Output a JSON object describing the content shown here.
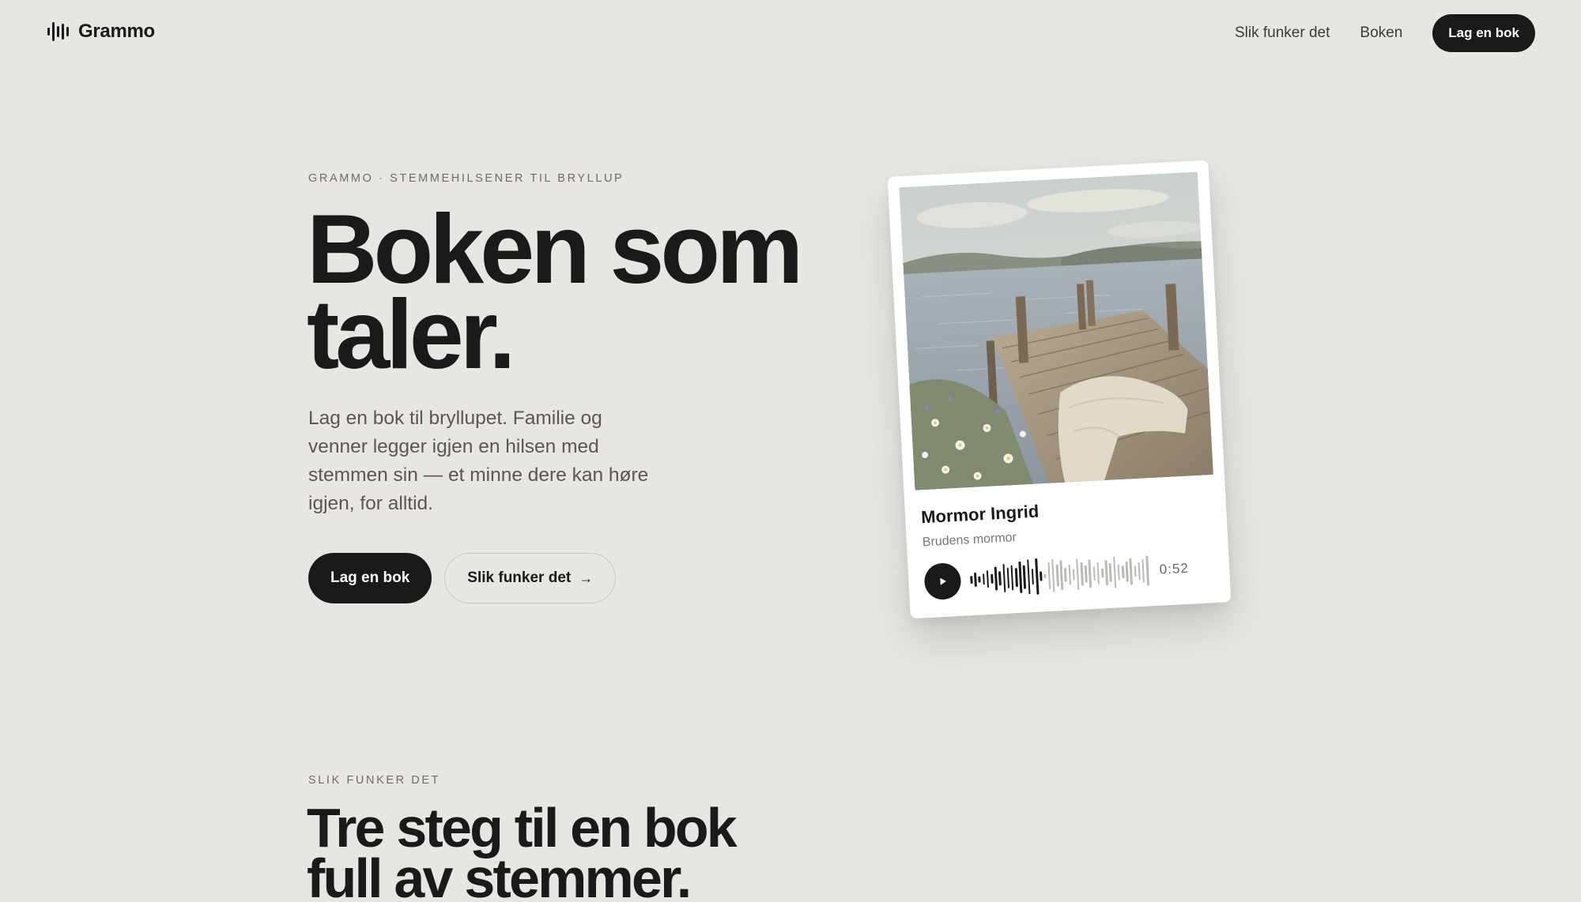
{
  "nav": {
    "brand": "Grammo",
    "links": [
      "Slik funker det",
      "Boken"
    ],
    "cta": "Lag en bok"
  },
  "hero": {
    "eyebrow": "GRAMMO · STEMMEHILSENER TIL BRYLLUP",
    "title_line1": "Boken som",
    "title_line2": "taler.",
    "body": "Lag en bok til bryllupet. Familie og venner legger igjen en hilsen med stemmen sin — et minne dere kan høre igjen, for alltid.",
    "primary_button": "Lag en bok",
    "secondary_button": "Slik funker det",
    "secondary_icon": "arrow-right-icon"
  },
  "card": {
    "name": "Mormor Ingrid",
    "role": "Brudens mormor",
    "time": "0:52",
    "play_icon": "play-icon",
    "waveform_played_fraction": 0.42
  },
  "section": {
    "eyebrow": "SLIK FUNKER DET",
    "title_line1": "Tre steg til en bok",
    "title_line2": "full av stemmer."
  },
  "colors": {
    "background": "#e8e6e2",
    "ink": "#1a1a1a",
    "muted": "#6f6c68",
    "wave_played": "#1a1a1a",
    "wave_unplayed": "#bdbab6"
  }
}
